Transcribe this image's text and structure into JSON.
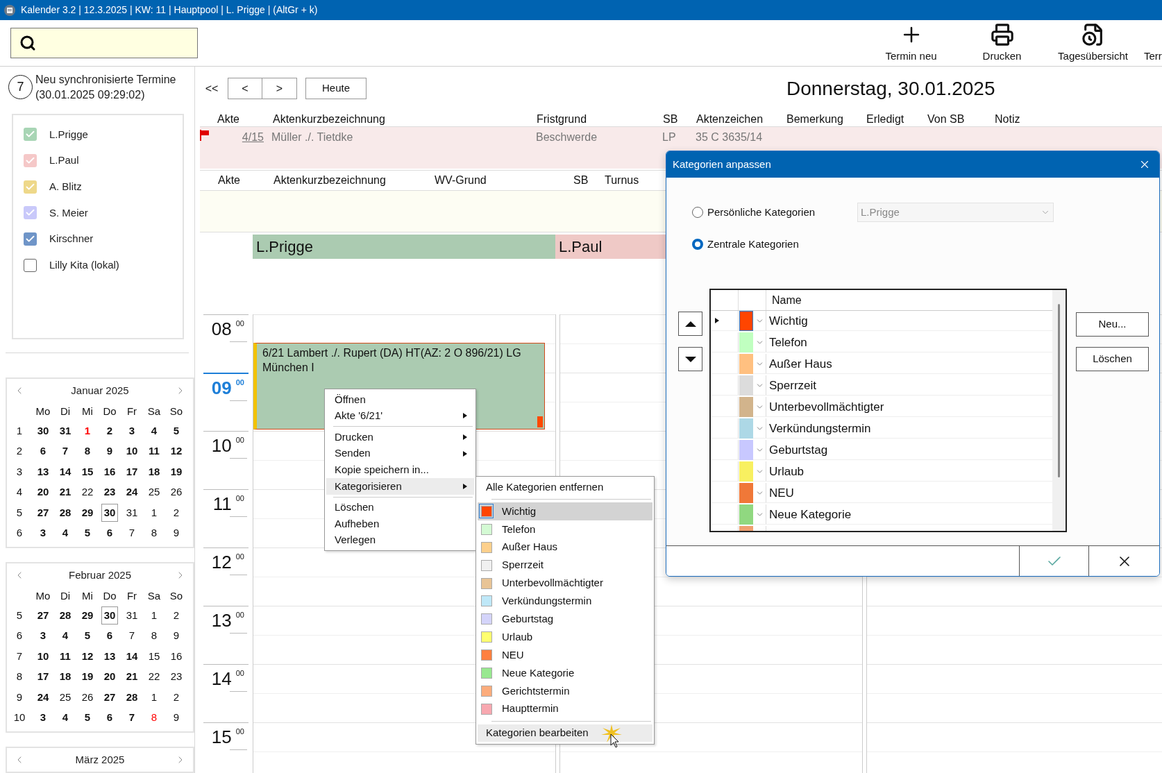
{
  "window": {
    "title": "Kalender 3.2 | 12.3.2025 | KW: 11 | Hauptpool | L. Prigge | (AltGr + k)"
  },
  "toolbar": [
    {
      "label": "Termin neu",
      "kind": "plus"
    },
    {
      "label": "Drucken",
      "kind": "printer"
    },
    {
      "label": "Tagesübersicht",
      "kind": "day-overview"
    },
    {
      "label": "Terr",
      "kind": "none"
    }
  ],
  "sync": {
    "count": "7",
    "text": "Neu synchronisierte Termine",
    "time": "(30.01.2025 09:29:02)"
  },
  "users": [
    {
      "name": "L.Prigge",
      "checked": true,
      "color": "#a8d5b5"
    },
    {
      "name": "L.Paul",
      "checked": true,
      "color": "#f5c8c8"
    },
    {
      "name": "A. Blitz",
      "checked": true,
      "color": "#eed88a"
    },
    {
      "name": "S. Meier",
      "checked": true,
      "color": "#c9c9fa"
    },
    {
      "name": "Kirschner",
      "checked": true,
      "color": "#6f95c8"
    },
    {
      "name": "Lilly Kita (lokal)",
      "checked": false,
      "color": "#ffffff"
    }
  ],
  "calendars": [
    {
      "title": "Januar 2025",
      "weekdays": [
        "Mo",
        "Di",
        "Mi",
        "Do",
        "Fr",
        "Sa",
        "So"
      ],
      "weeks": [
        {
          "number": "1",
          "days": [
            {
              "d": "30",
              "bold": true,
              "holiday": false,
              "selected": false
            },
            {
              "d": "31",
              "bold": true,
              "holiday": false,
              "selected": false
            },
            {
              "d": "1",
              "bold": true,
              "holiday": true,
              "selected": false
            },
            {
              "d": "2",
              "bold": true,
              "holiday": false,
              "selected": false
            },
            {
              "d": "3",
              "bold": true,
              "holiday": false,
              "selected": false
            },
            {
              "d": "4",
              "bold": true,
              "holiday": false,
              "selected": false
            },
            {
              "d": "5",
              "bold": true,
              "holiday": false,
              "selected": false
            }
          ]
        },
        {
          "number": "2",
          "days": [
            {
              "d": "6",
              "bold": true,
              "holiday": false,
              "selected": false
            },
            {
              "d": "7",
              "bold": true,
              "holiday": false,
              "selected": false
            },
            {
              "d": "8",
              "bold": true,
              "holiday": false,
              "selected": false
            },
            {
              "d": "9",
              "bold": true,
              "holiday": false,
              "selected": false
            },
            {
              "d": "10",
              "bold": true,
              "holiday": false,
              "selected": false
            },
            {
              "d": "11",
              "bold": true,
              "holiday": false,
              "selected": false
            },
            {
              "d": "12",
              "bold": true,
              "holiday": false,
              "selected": false
            }
          ]
        },
        {
          "number": "3",
          "days": [
            {
              "d": "13",
              "bold": true,
              "holiday": false,
              "selected": false
            },
            {
              "d": "14",
              "bold": true,
              "holiday": false,
              "selected": false
            },
            {
              "d": "15",
              "bold": true,
              "holiday": false,
              "selected": false
            },
            {
              "d": "16",
              "bold": true,
              "holiday": false,
              "selected": false
            },
            {
              "d": "17",
              "bold": true,
              "holiday": false,
              "selected": false
            },
            {
              "d": "18",
              "bold": true,
              "holiday": false,
              "selected": false
            },
            {
              "d": "19",
              "bold": true,
              "holiday": false,
              "selected": false
            }
          ]
        },
        {
          "number": "4",
          "days": [
            {
              "d": "20",
              "bold": true,
              "holiday": false,
              "selected": false
            },
            {
              "d": "21",
              "bold": true,
              "holiday": false,
              "selected": false
            },
            {
              "d": "22",
              "bold": false,
              "holiday": false,
              "selected": false
            },
            {
              "d": "23",
              "bold": true,
              "holiday": false,
              "selected": false
            },
            {
              "d": "24",
              "bold": true,
              "holiday": false,
              "selected": false
            },
            {
              "d": "25",
              "bold": false,
              "holiday": false,
              "selected": false
            },
            {
              "d": "26",
              "bold": false,
              "holiday": false,
              "selected": false
            }
          ]
        },
        {
          "number": "5",
          "days": [
            {
              "d": "27",
              "bold": true,
              "holiday": false,
              "selected": false
            },
            {
              "d": "28",
              "bold": true,
              "holiday": false,
              "selected": false
            },
            {
              "d": "29",
              "bold": true,
              "holiday": false,
              "selected": false
            },
            {
              "d": "30",
              "bold": true,
              "holiday": false,
              "selected": true
            },
            {
              "d": "31",
              "bold": false,
              "holiday": false,
              "selected": false
            },
            {
              "d": "1",
              "bold": false,
              "holiday": false,
              "selected": false
            },
            {
              "d": "2",
              "bold": false,
              "holiday": false,
              "selected": false
            }
          ]
        },
        {
          "number": "6",
          "days": [
            {
              "d": "3",
              "bold": true,
              "holiday": false,
              "selected": false
            },
            {
              "d": "4",
              "bold": true,
              "holiday": false,
              "selected": false
            },
            {
              "d": "5",
              "bold": true,
              "holiday": false,
              "selected": false
            },
            {
              "d": "6",
              "bold": true,
              "holiday": false,
              "selected": false
            },
            {
              "d": "7",
              "bold": false,
              "holiday": false,
              "selected": false
            },
            {
              "d": "8",
              "bold": false,
              "holiday": false,
              "selected": false
            },
            {
              "d": "9",
              "bold": false,
              "holiday": false,
              "selected": false
            }
          ]
        }
      ]
    },
    {
      "title": "Februar 2025",
      "weekdays": [
        "Mo",
        "Di",
        "Mi",
        "Do",
        "Fr",
        "Sa",
        "So"
      ],
      "weeks": [
        {
          "number": "5",
          "days": [
            {
              "d": "27",
              "bold": true,
              "holiday": false,
              "selected": false
            },
            {
              "d": "28",
              "bold": true,
              "holiday": false,
              "selected": false
            },
            {
              "d": "29",
              "bold": true,
              "holiday": false,
              "selected": false
            },
            {
              "d": "30",
              "bold": true,
              "holiday": false,
              "selected": true
            },
            {
              "d": "31",
              "bold": false,
              "holiday": false,
              "selected": false
            },
            {
              "d": "1",
              "bold": false,
              "holiday": false,
              "selected": false
            },
            {
              "d": "2",
              "bold": false,
              "holiday": false,
              "selected": false
            }
          ]
        },
        {
          "number": "6",
          "days": [
            {
              "d": "3",
              "bold": true,
              "holiday": false,
              "selected": false
            },
            {
              "d": "4",
              "bold": true,
              "holiday": false,
              "selected": false
            },
            {
              "d": "5",
              "bold": true,
              "holiday": false,
              "selected": false
            },
            {
              "d": "6",
              "bold": true,
              "holiday": false,
              "selected": false
            },
            {
              "d": "7",
              "bold": false,
              "holiday": false,
              "selected": false
            },
            {
              "d": "8",
              "bold": false,
              "holiday": false,
              "selected": false
            },
            {
              "d": "9",
              "bold": false,
              "holiday": false,
              "selected": false
            }
          ]
        },
        {
          "number": "7",
          "days": [
            {
              "d": "10",
              "bold": true,
              "holiday": false,
              "selected": false
            },
            {
              "d": "11",
              "bold": true,
              "holiday": false,
              "selected": false
            },
            {
              "d": "12",
              "bold": true,
              "holiday": false,
              "selected": false
            },
            {
              "d": "13",
              "bold": true,
              "holiday": false,
              "selected": false
            },
            {
              "d": "14",
              "bold": true,
              "holiday": false,
              "selected": false
            },
            {
              "d": "15",
              "bold": false,
              "holiday": false,
              "selected": false
            },
            {
              "d": "16",
              "bold": false,
              "holiday": false,
              "selected": false
            }
          ]
        },
        {
          "number": "8",
          "days": [
            {
              "d": "17",
              "bold": true,
              "holiday": false,
              "selected": false
            },
            {
              "d": "18",
              "bold": true,
              "holiday": false,
              "selected": false
            },
            {
              "d": "19",
              "bold": true,
              "holiday": false,
              "selected": false
            },
            {
              "d": "20",
              "bold": true,
              "holiday": false,
              "selected": false
            },
            {
              "d": "21",
              "bold": true,
              "holiday": false,
              "selected": false
            },
            {
              "d": "22",
              "bold": false,
              "holiday": false,
              "selected": false
            },
            {
              "d": "23",
              "bold": false,
              "holiday": false,
              "selected": false
            }
          ]
        },
        {
          "number": "9",
          "days": [
            {
              "d": "24",
              "bold": true,
              "holiday": false,
              "selected": false
            },
            {
              "d": "25",
              "bold": false,
              "holiday": false,
              "selected": false
            },
            {
              "d": "26",
              "bold": false,
              "holiday": false,
              "selected": false
            },
            {
              "d": "27",
              "bold": true,
              "holiday": false,
              "selected": false
            },
            {
              "d": "28",
              "bold": true,
              "holiday": false,
              "selected": false
            },
            {
              "d": "1",
              "bold": false,
              "holiday": false,
              "selected": false
            },
            {
              "d": "2",
              "bold": false,
              "holiday": false,
              "selected": false
            }
          ]
        },
        {
          "number": "10",
          "days": [
            {
              "d": "3",
              "bold": true,
              "holiday": false,
              "selected": false
            },
            {
              "d": "4",
              "bold": true,
              "holiday": false,
              "selected": false
            },
            {
              "d": "5",
              "bold": true,
              "holiday": false,
              "selected": false
            },
            {
              "d": "6",
              "bold": true,
              "holiday": false,
              "selected": false
            },
            {
              "d": "7",
              "bold": true,
              "holiday": false,
              "selected": false
            },
            {
              "d": "8",
              "bold": false,
              "holiday": true,
              "selected": false
            },
            {
              "d": "9",
              "bold": false,
              "holiday": false,
              "selected": false
            }
          ]
        }
      ]
    },
    {
      "title": "März 2025"
    }
  ],
  "nav": {
    "first": "<<",
    "prev": "<",
    "next": ">",
    "today": "Heute",
    "date": "Donnerstag, 30.01.2025"
  },
  "deadlines": {
    "columns": [
      "Akte",
      "Aktenkurzbezeichnung",
      "Fristgrund",
      "SB",
      "Aktenzeichen",
      "Bemerkung",
      "Erledigt",
      "Von SB",
      "Notiz"
    ],
    "rows": [
      {
        "flagged": true,
        "akte": "4/15",
        "title": "Müller ./. Tietdke",
        "reason": "Beschwerde",
        "sb": "LP",
        "file_number": "35 C 3635/14"
      }
    ]
  },
  "resubmissions": {
    "columns": [
      "Akte",
      "Aktenkurzbezeichnung",
      "WV-Grund",
      "SB",
      "Turnus"
    ]
  },
  "day_view": {
    "resources": [
      {
        "name": "L.Prigge",
        "color": "#abcbb1"
      },
      {
        "name": "L.Paul",
        "color": "#efc9c6"
      }
    ],
    "hours": [
      {
        "hour": "08",
        "minutes": "00",
        "current": false
      },
      {
        "hour": "09",
        "minutes": "00",
        "current": true
      },
      {
        "hour": "10",
        "minutes": "00",
        "current": false
      },
      {
        "hour": "11",
        "minutes": "00",
        "current": false
      },
      {
        "hour": "12",
        "minutes": "00",
        "current": false
      },
      {
        "hour": "13",
        "minutes": "00",
        "current": false
      },
      {
        "hour": "14",
        "minutes": "00",
        "current": false
      },
      {
        "hour": "15",
        "minutes": "00",
        "current": false
      }
    ],
    "events": [
      {
        "text": "6/21 Lambert ./. Rupert (DA) HT(AZ: 2 O 896/21) LG München I",
        "color": "#ff4a00"
      }
    ]
  },
  "context_menu": {
    "items": [
      {
        "kind": "item",
        "label": "Öffnen",
        "submenu": false,
        "highlighted": false
      },
      {
        "kind": "item",
        "label": "Akte '6/21'",
        "submenu": true,
        "highlighted": false
      },
      {
        "kind": "separator"
      },
      {
        "kind": "item",
        "label": "Drucken",
        "submenu": true,
        "highlighted": false
      },
      {
        "kind": "item",
        "label": "Senden",
        "submenu": true,
        "highlighted": false
      },
      {
        "kind": "item",
        "label": "Kopie speichern in...",
        "submenu": false,
        "highlighted": false
      },
      {
        "kind": "item",
        "label": "Kategorisieren",
        "submenu": true,
        "highlighted": true
      },
      {
        "kind": "separator"
      },
      {
        "kind": "item",
        "label": "Löschen",
        "submenu": false,
        "highlighted": false
      },
      {
        "kind": "item",
        "label": "Aufheben",
        "submenu": false,
        "highlighted": false
      },
      {
        "kind": "item",
        "label": "Verlegen",
        "submenu": false,
        "highlighted": false
      }
    ]
  },
  "category_menu": {
    "items": [
      {
        "kind": "action",
        "label": "Alle Kategorien entfernen",
        "highlighted": false
      },
      {
        "kind": "separator"
      },
      {
        "kind": "category",
        "label": "Wichtig",
        "color": "#ff4500",
        "checked": true
      },
      {
        "kind": "category",
        "label": "Telefon",
        "color": "#d4fad4",
        "checked": false
      },
      {
        "kind": "category",
        "label": "Außer Haus",
        "color": "#fdd08c",
        "checked": false
      },
      {
        "kind": "category",
        "label": "Sperrzeit",
        "color": "#f0f0f0",
        "checked": false
      },
      {
        "kind": "category",
        "label": "Unterbevollmächtigter",
        "color": "#e8c496",
        "checked": false
      },
      {
        "kind": "category",
        "label": "Verkündungstermin",
        "color": "#bfe8f8",
        "checked": false
      },
      {
        "kind": "category",
        "label": "Geburtstag",
        "color": "#d4d4fa",
        "checked": false
      },
      {
        "kind": "category",
        "label": "Urlaub",
        "color": "#ffff70",
        "checked": false
      },
      {
        "kind": "category",
        "label": "NEU",
        "color": "#ff8040",
        "checked": false
      },
      {
        "kind": "category",
        "label": "Neue Kategorie",
        "color": "#98e890",
        "checked": false
      },
      {
        "kind": "category",
        "label": "Gerichtstermin",
        "color": "#fcac7c",
        "checked": false
      },
      {
        "kind": "category",
        "label": "Haupttermin",
        "color": "#f8a8b0",
        "checked": false
      },
      {
        "kind": "separator"
      },
      {
        "kind": "action",
        "label": "Kategorien bearbeiten",
        "highlighted": true
      }
    ]
  },
  "dialog": {
    "title": "Kategorien anpassen",
    "options": [
      {
        "label": "Persönliche Kategorien",
        "selected": false
      },
      {
        "label": "Zentrale Kategorien",
        "selected": true
      }
    ],
    "user_select": {
      "value": "L.Prigge",
      "disabled": true
    },
    "table": {
      "columns": [
        "Name"
      ],
      "rows": [
        {
          "name": "Wichtig",
          "color": "#ff4500",
          "current": true
        },
        {
          "name": "Telefon",
          "color": "#c0ffc0",
          "current": false
        },
        {
          "name": "Außer Haus",
          "color": "#ffc080",
          "current": false
        },
        {
          "name": "Sperrzeit",
          "color": "#dcdcdc",
          "current": false
        },
        {
          "name": "Unterbevollmächtigter",
          "color": "#d2b48c",
          "current": false
        },
        {
          "name": "Verkündungstermin",
          "color": "#add8e6",
          "current": false
        },
        {
          "name": "Geburtstag",
          "color": "#c8c8ff",
          "current": false
        },
        {
          "name": "Urlaub",
          "color": "#f8f060",
          "current": false
        },
        {
          "name": "NEU",
          "color": "#f07838",
          "current": false
        },
        {
          "name": "Neue Kategorie",
          "color": "#90d880",
          "current": false
        },
        {
          "color": "#f0a070",
          "current": false
        }
      ]
    },
    "buttons": [
      "Neu...",
      "Löschen"
    ]
  }
}
